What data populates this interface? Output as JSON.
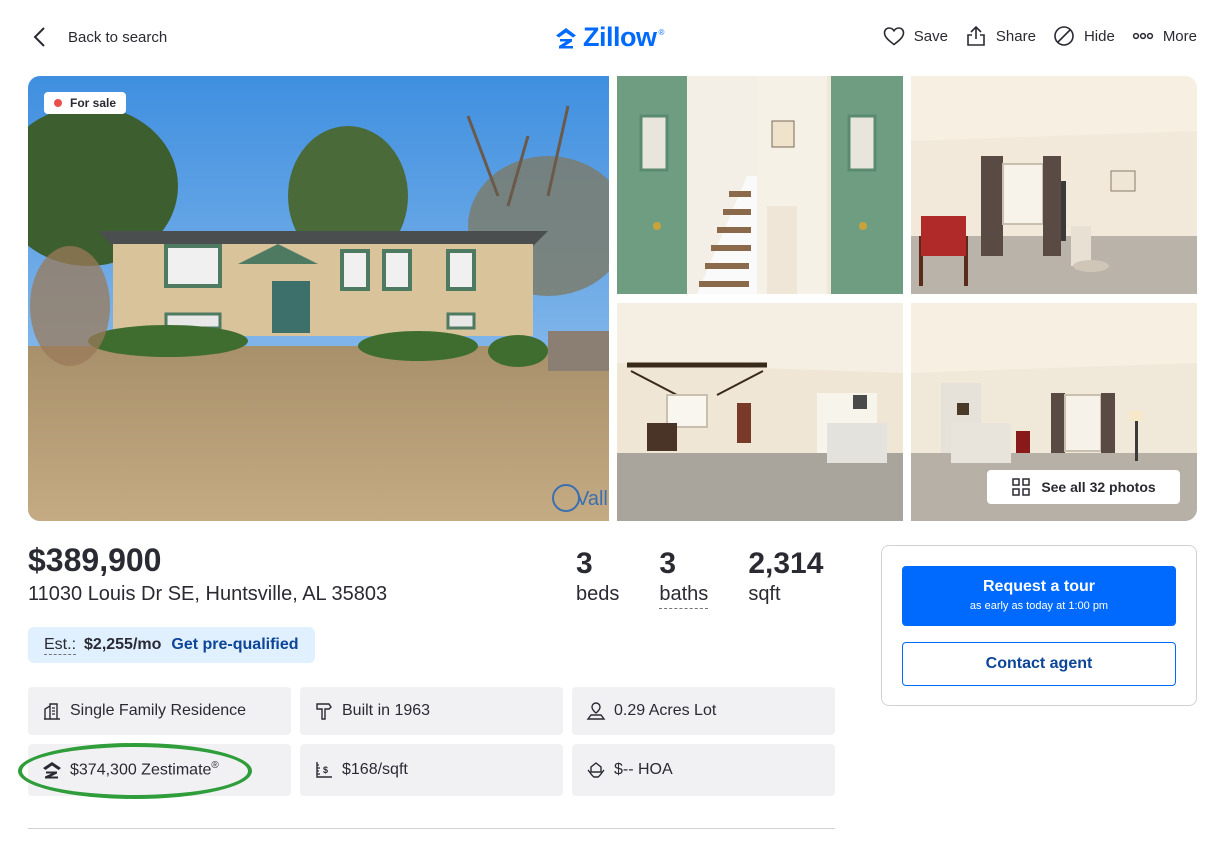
{
  "nav": {
    "back_label": "Back to search",
    "logo_text": "Zillow",
    "logo_mark": "®",
    "actions": [
      {
        "label": "Save",
        "icon": "heart-icon"
      },
      {
        "label": "Share",
        "icon": "share-icon"
      },
      {
        "label": "Hide",
        "icon": "hide-icon"
      },
      {
        "label": "More",
        "icon": "more-icon"
      }
    ]
  },
  "gallery": {
    "status_badge": "For sale",
    "see_all_label": "See all 32 photos",
    "photo_watermark": "Vall"
  },
  "listing": {
    "price": "$389,900",
    "address": "11030 Louis Dr SE, Huntsville, AL 35803",
    "beds": {
      "value": "3",
      "label": "beds"
    },
    "baths": {
      "value": "3",
      "label": "baths"
    },
    "sqft": {
      "value": "2,314",
      "label": "sqft"
    },
    "estimate": {
      "label": "Est.:",
      "amount": "$2,255/mo",
      "link": "Get pre-qualified"
    }
  },
  "facts": [
    {
      "text": "Single Family Residence",
      "icon": "building-icon"
    },
    {
      "text": "Built in 1963",
      "icon": "hammer-icon"
    },
    {
      "text": "0.29 Acres Lot",
      "icon": "lot-icon"
    },
    {
      "text": "$374,300 Zestimate",
      "sup": "®",
      "icon": "zillow-icon"
    },
    {
      "text": "$168/sqft",
      "icon": "price-sqft-icon"
    },
    {
      "text": "$-- HOA",
      "icon": "hoa-icon"
    }
  ],
  "tour_card": {
    "request_label": "Request a tour",
    "request_sub": "as early as today at 1:00 pm",
    "contact_label": "Contact agent"
  },
  "colors": {
    "brand": "#006aff",
    "annotation_circle": "#2e9d3a",
    "status_dot": "#e8504e"
  }
}
